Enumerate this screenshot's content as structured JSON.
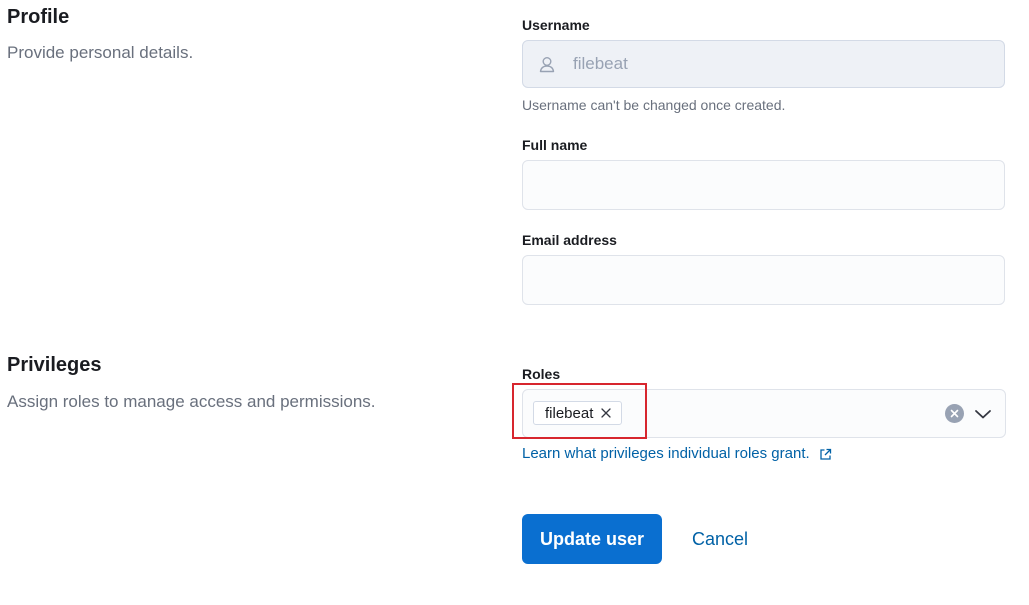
{
  "profile": {
    "title": "Profile",
    "description": "Provide personal details.",
    "username_label": "Username",
    "username_value": "filebeat",
    "username_help": "Username can't be changed once created.",
    "full_name_label": "Full name",
    "full_name_value": "",
    "email_label": "Email address",
    "email_value": ""
  },
  "privileges": {
    "title": "Privileges",
    "description": "Assign roles to manage access and permissions.",
    "roles_label": "Roles",
    "roles": [
      "filebeat"
    ],
    "roles_help_link": "Learn what privileges individual roles grant."
  },
  "actions": {
    "primary_label": "Update user",
    "cancel_label": "Cancel"
  },
  "colors": {
    "primary": "#0a6fd0",
    "link": "#0061a6",
    "highlight": "#d7262e"
  },
  "icons": {
    "username": "user-icon",
    "pill_remove": "cross-icon",
    "clear": "clear-circle-icon",
    "caret": "chevron-down-icon",
    "external": "external-link-icon"
  }
}
